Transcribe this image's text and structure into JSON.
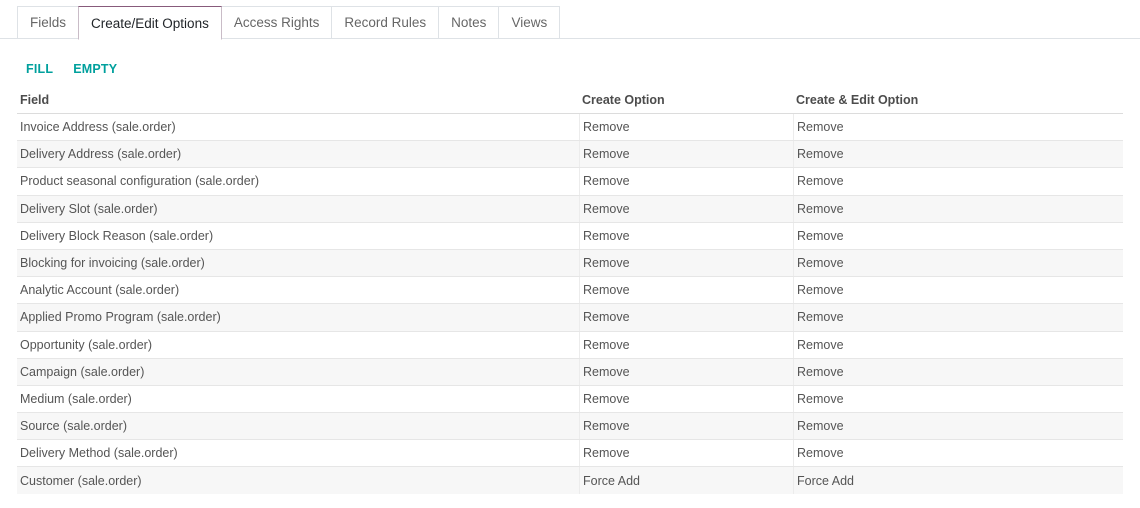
{
  "tabs": [
    {
      "label": "Fields",
      "active": false
    },
    {
      "label": "Create/Edit Options",
      "active": true
    },
    {
      "label": "Access Rights",
      "active": false
    },
    {
      "label": "Record Rules",
      "active": false
    },
    {
      "label": "Notes",
      "active": false
    },
    {
      "label": "Views",
      "active": false
    }
  ],
  "actions": {
    "fill_label": "FILL",
    "empty_label": "EMPTY"
  },
  "table": {
    "headers": {
      "field": "Field",
      "create": "Create Option",
      "create_edit": "Create & Edit Option"
    },
    "rows": [
      {
        "field": "Invoice Address (sale.order)",
        "create": "Remove",
        "create_edit": "Remove"
      },
      {
        "field": "Delivery Address (sale.order)",
        "create": "Remove",
        "create_edit": "Remove"
      },
      {
        "field": "Product seasonal configuration (sale.order)",
        "create": "Remove",
        "create_edit": "Remove"
      },
      {
        "field": "Delivery Slot (sale.order)",
        "create": "Remove",
        "create_edit": "Remove"
      },
      {
        "field": "Delivery Block Reason (sale.order)",
        "create": "Remove",
        "create_edit": "Remove"
      },
      {
        "field": "Blocking for invoicing (sale.order)",
        "create": "Remove",
        "create_edit": "Remove"
      },
      {
        "field": "Analytic Account (sale.order)",
        "create": "Remove",
        "create_edit": "Remove"
      },
      {
        "field": "Applied Promo Program (sale.order)",
        "create": "Remove",
        "create_edit": "Remove"
      },
      {
        "field": "Opportunity (sale.order)",
        "create": "Remove",
        "create_edit": "Remove"
      },
      {
        "field": "Campaign (sale.order)",
        "create": "Remove",
        "create_edit": "Remove"
      },
      {
        "field": "Medium (sale.order)",
        "create": "Remove",
        "create_edit": "Remove"
      },
      {
        "field": "Source (sale.order)",
        "create": "Remove",
        "create_edit": "Remove"
      },
      {
        "field": "Delivery Method (sale.order)",
        "create": "Remove",
        "create_edit": "Remove"
      },
      {
        "field": "Customer (sale.order)",
        "create": "Force Add",
        "create_edit": "Force Add"
      }
    ]
  },
  "colors": {
    "accent": "#00a09d",
    "active_tab_top": "#875a7b"
  }
}
